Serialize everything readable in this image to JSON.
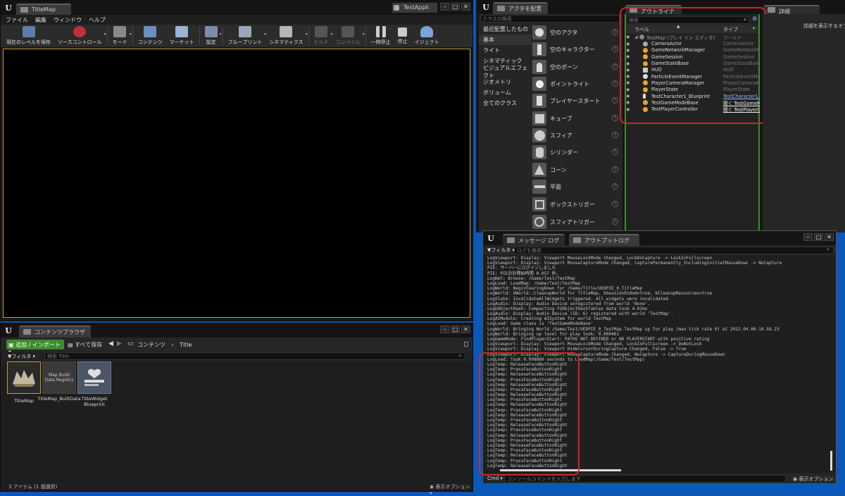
{
  "main_window": {
    "tab_title": "TitleMap",
    "project_badge": "TestAppli",
    "menu": [
      "ファイル",
      "編集",
      "ウィンドウ",
      "ヘルプ"
    ],
    "toolbar": [
      {
        "label": "現在のレベルを保存",
        "icon": "save-icon"
      },
      {
        "label": "ソースコントロール",
        "icon": "source-control-icon"
      },
      {
        "label": "モード",
        "icon": "modes-icon"
      },
      {
        "label": "コンテンツ",
        "icon": "content-icon"
      },
      {
        "label": "マーケット",
        "icon": "marketplace-icon"
      },
      {
        "label": "設定",
        "icon": "settings-icon"
      },
      {
        "label": "ブループリント",
        "icon": "blueprint-icon"
      },
      {
        "label": "シネマティクス",
        "icon": "cinematics-icon"
      },
      {
        "label": "ビルド",
        "icon": "build-icon"
      },
      {
        "label": "コンパイル",
        "icon": "compile-icon"
      },
      {
        "label": "一時停止",
        "icon": "pause-icon"
      },
      {
        "label": "停止",
        "icon": "stop-icon"
      },
      {
        "label": "イジェクト",
        "icon": "eject-icon"
      }
    ]
  },
  "place_actors": {
    "tab_title": "アクタを配置",
    "search_placeholder": "クラスの検索",
    "categories": [
      "最近配置したもの",
      "基本",
      "ライト",
      "シネマティック",
      "ビジュアルエフェクト",
      "ジオメトリ",
      "ボリューム",
      "全てのクラス"
    ],
    "items": [
      "空のアクタ",
      "空のキャラクター",
      "空のポーン",
      "ポイントライト",
      "プレイヤースタート",
      "キューブ",
      "スフィア",
      "シリンダー",
      "コーン",
      "平面",
      "ボックストリガー",
      "スフィアトリガー"
    ]
  },
  "outliner": {
    "tab_title": "アウトライナ",
    "search_placeholder": "検索",
    "col_label": "ラベル",
    "col_type": "タイプ",
    "root": {
      "name": "TestMap (プレイ イン エディタ)",
      "type": "ワールド"
    },
    "rows": [
      {
        "name": "CameraActor",
        "type": "CameraActor"
      },
      {
        "name": "GameNetworkManager",
        "type": "GameNetworkMan"
      },
      {
        "name": "GameSession",
        "type": "GameSession"
      },
      {
        "name": "GameStateBase",
        "type": "GameStateBase"
      },
      {
        "name": "HUD",
        "type": "HUD"
      },
      {
        "name": "ParticleEventManager",
        "type": "ParticleEventMana"
      },
      {
        "name": "PlayerCameraManager",
        "type": "PlayerCameraMan"
      },
      {
        "name": "PlayerState",
        "type": "PlayerState"
      },
      {
        "name": "TestCharacter1_Blueprint",
        "type": "TestCharacter1_"
      },
      {
        "name": "TestGameModeBase",
        "type": "開く TestGameM"
      },
      {
        "name": "TestPlayerController",
        "type": "開く TestPlayerC"
      }
    ]
  },
  "details": {
    "tab_title": "詳細",
    "hint": "詳細を表示するオブ"
  },
  "content_browser": {
    "tab_title": "コンテンツブラウザ",
    "add_import_label": "追加 / インポート",
    "save_all_label": "すべて保存",
    "path": [
      "コンテンツ",
      "Title"
    ],
    "filter_label": "フィルタ",
    "search_placeholder": "検索 Title",
    "assets": [
      {
        "label": "TitleMap",
        "thumb": ""
      },
      {
        "label": "TitleMap_BuiltData",
        "thumb": "Map Build Data Registry"
      },
      {
        "label": "TitleWidget Blueprint",
        "thumb": ""
      }
    ],
    "item_count": "3 アイテム (1 個選択)",
    "view_options": "表示オプション"
  },
  "output_log": {
    "tab_messages": "メッセージ ログ",
    "tab_output": "アウトプットログ",
    "filter_label": "フィルタ",
    "search_placeholder": "ログを検索",
    "cmd_label": "Cmd",
    "cmd_placeholder": "コンソールコマンドを入力します",
    "view_options": "表示オプション",
    "lines": [
      "LogViewport: Display: Viewport MouseLockMode Changed, LockOnCapture -> LockInFullscreen",
      "LogViewport: Display: Viewport MouseCaptureMode Changed, CapturePermanently_IncludingInitialMouseDown -> NoCapture",
      "PIE: サーバーにログインしました",
      "PIE: PIE合計開始時間 0.057 秒。",
      "LogNet: Browse: /Game/Test/TestMap",
      "LogLoad: LoadMap: /Game/Test/TestMap",
      "LogWorld: BeginTearingDown for /Game/Title/UEDPIE_0_TitleMap",
      "LogWorld: UWorld::CleanupWorld for TitleMap, bSessionEnded=true, bCleanupResources=true",
      "LogSlate: InvalidateAllWidgets triggered.  All widgets were invalidated",
      "LogAudio: Display: Audio Device unregistered from world 'None'.",
      "LogUObjectHash: Compacting FUObjectHashTables data took   4.01ms",
      "LogAudio: Display: Audio Device (ID: 6) registered with world 'TestMap'.",
      "LogAIModule: Creating AISystem for world TestMap",
      "LogLoad: Game class is 'TestGameModeBase'",
      "LogWorld: Bringing World /Game/Test/UEDPIE_0_TestMap.TestMap up for play (max tick rate 0) at 2022.04.06-14.58.23",
      "LogWorld: Bringing up level for play took: 0.000461",
      "LogGameMode: FindPlayerStart: PATHS NOT DEFINED or NO PLAYERSTART with positive rating",
      "LogViewport: Display: Viewport MouseLockMode Changed, LockInFullscreen -> DoNotLock",
      "LogViewport: Display: Viewport HideCursorDuringCapture Changed, False -> True",
      "LogViewport: Display: Viewport MouseCaptureMode Changed, NoCapture -> CaptureDuringMouseDown",
      "LogLoad: Took 0.098860 seconds to LoadMap(/Game/Test/TestMap)",
      "LogTemp: ReleaseFaceButtonRight",
      "LogTemp: PressFaceButtonRight",
      "LogTemp: ReleaseFaceButtonRight",
      "LogTemp: PressFaceButtonRight",
      "LogTemp: ReleaseFaceButtonRight",
      "LogTemp: PressFaceButtonRight",
      "LogTemp: ReleaseFaceButtonRight",
      "LogTemp: PressFaceButtonRight",
      "LogTemp: ReleaseFaceButtonRight",
      "LogTemp: PressFaceButtonRight",
      "LogTemp: ReleaseFaceButtonRight",
      "LogTemp: PressFaceButtonRight",
      "LogTemp: ReleaseFaceButtonRight",
      "LogTemp: PressFaceButtonRight",
      "LogTemp: ReleaseFaceButtonRight",
      "LogTemp: PressFaceButtonRight",
      "LogTemp: ReleaseFaceButtonRight",
      "LogTemp: PressFaceButtonRight",
      "LogTemp: ReleaseFaceButtonRight",
      "LogTemp: PressFaceButtonRight",
      "LogTemp: ReleaseFaceButtonRight"
    ]
  },
  "colors": {
    "desktop": "#0a58b8",
    "highlight_box": "#d4232a",
    "viewport_border": "#c59a35",
    "add_button": "#3f8c2e"
  }
}
